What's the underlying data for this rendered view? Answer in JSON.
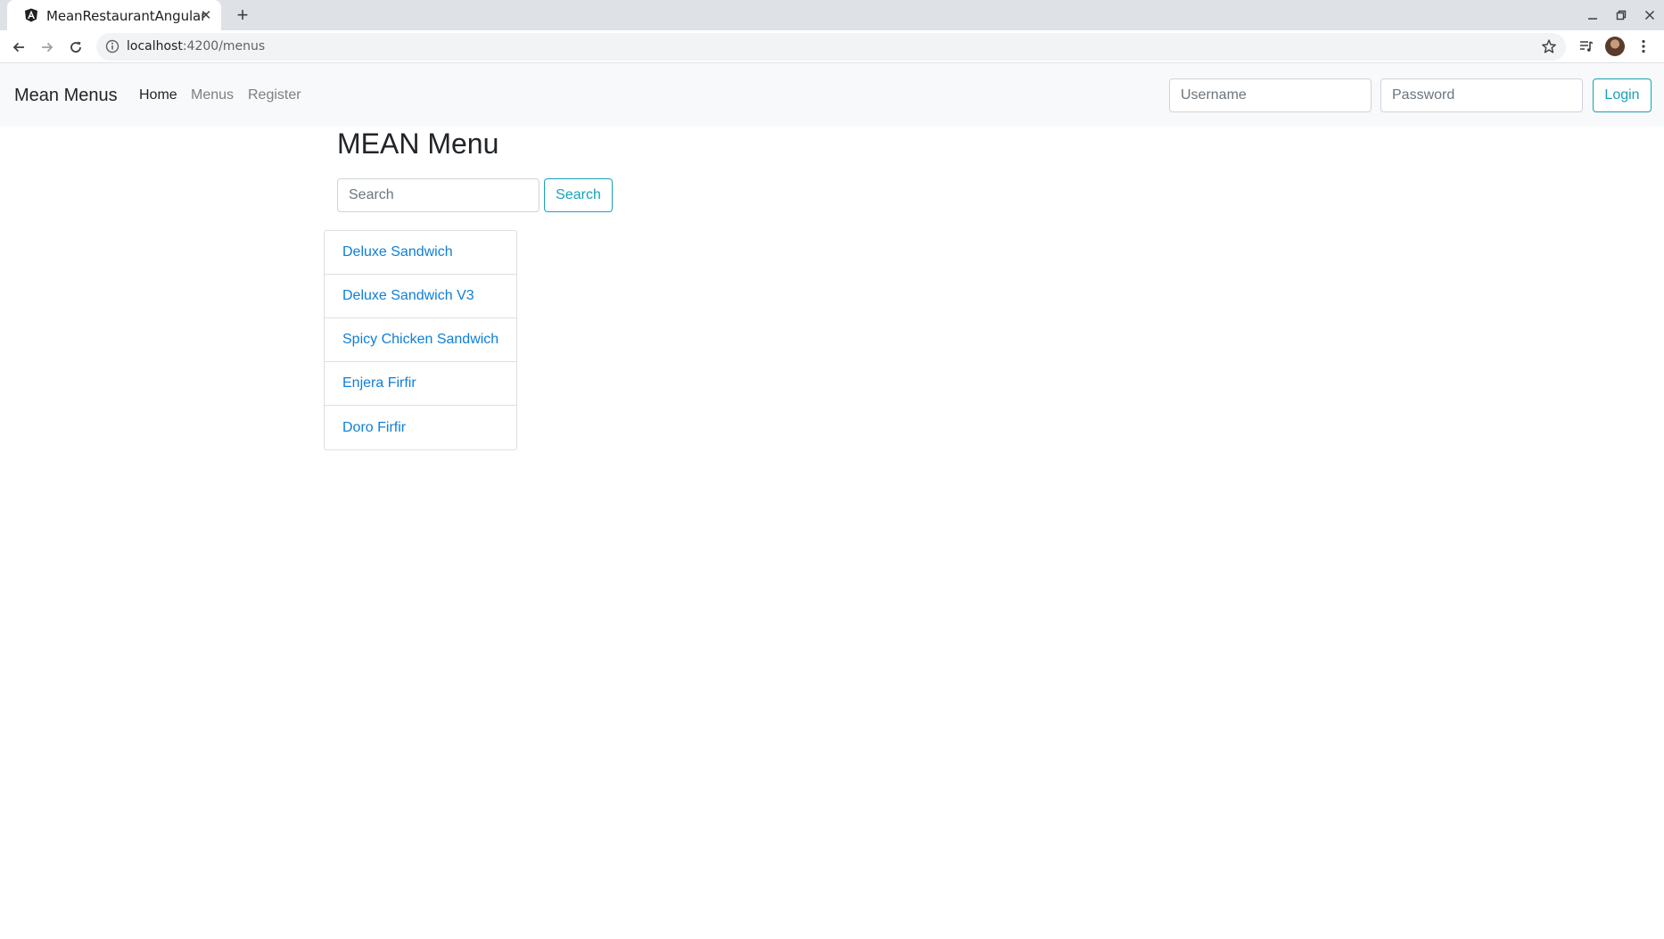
{
  "browser": {
    "tab_title": "MeanRestaurantAngular",
    "url_host": "localhost",
    "url_path": ":4200/menus"
  },
  "navbar": {
    "brand": "Mean Menus",
    "links": [
      {
        "label": "Home",
        "active": true
      },
      {
        "label": "Menus",
        "active": false
      },
      {
        "label": "Register",
        "active": false
      }
    ],
    "username_placeholder": "Username",
    "password_placeholder": "Password",
    "login_label": "Login"
  },
  "main": {
    "title": "MEAN Menu",
    "search_placeholder": "Search",
    "search_label": "Search",
    "menus": [
      {
        "name": "Deluxe Sandwich"
      },
      {
        "name": "Deluxe Sandwich V3"
      },
      {
        "name": "Spicy Chicken Sandwich"
      },
      {
        "name": "Enjera Firfir"
      },
      {
        "name": "Doro Firfir"
      }
    ]
  },
  "colors": {
    "accent": "#17a2b8",
    "link": "#0f7fd8",
    "navbar_bg": "#f8f9fa"
  }
}
